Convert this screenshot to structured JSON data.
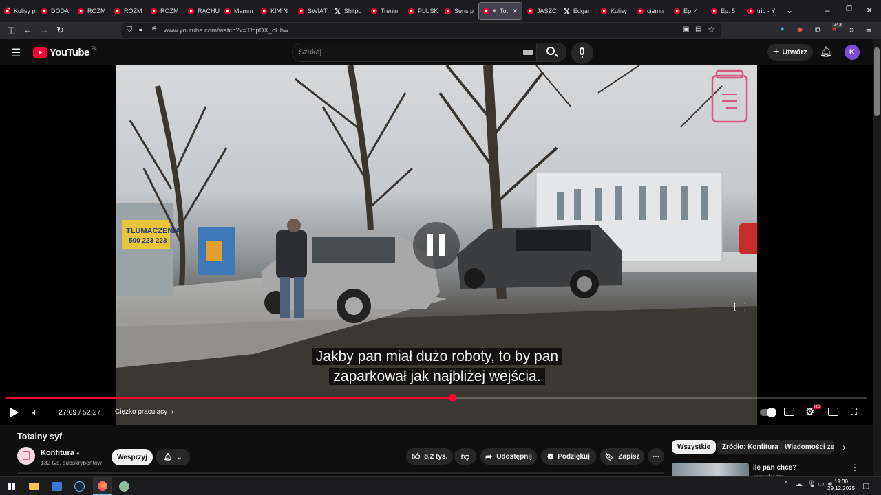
{
  "browser": {
    "tabs": [
      {
        "label": "Kulisy p",
        "icon": "youtube"
      },
      {
        "label": "DODA",
        "icon": "youtube"
      },
      {
        "label": "ROZM",
        "icon": "youtube"
      },
      {
        "label": "ROZM",
        "icon": "youtube"
      },
      {
        "label": "ROZM",
        "icon": "youtube"
      },
      {
        "label": "RACHU",
        "icon": "youtube"
      },
      {
        "label": "Mamm",
        "icon": "youtube"
      },
      {
        "label": "KIM N",
        "icon": "youtube"
      },
      {
        "label": "ŚWIĄT",
        "icon": "youtube"
      },
      {
        "label": "Shitpo",
        "icon": "x"
      },
      {
        "label": "Trenin",
        "icon": "youtube"
      },
      {
        "label": "PLUSK",
        "icon": "youtube"
      },
      {
        "label": "Sens p",
        "icon": "youtube"
      },
      {
        "label": "Tot",
        "icon": "youtube",
        "active": true
      },
      {
        "label": "JASZC",
        "icon": "youtube"
      },
      {
        "label": "Edgar",
        "icon": "x"
      },
      {
        "label": "Kulisy",
        "icon": "youtube"
      },
      {
        "label": "ciemn",
        "icon": "youtube"
      },
      {
        "label": "Ep. 4",
        "icon": "youtube"
      },
      {
        "label": "Ep. 5",
        "icon": "youtube"
      },
      {
        "label": "trip - Y",
        "icon": "youtube"
      }
    ],
    "url": "www.youtube.com/watch?v=TfcpDX_cHbw",
    "extension_badge": "243"
  },
  "youtube": {
    "logo": "YouTube",
    "region": "PL",
    "search_placeholder": "Szukaj",
    "create_label": "Utwórz",
    "avatar_letter": "K"
  },
  "player": {
    "caption_line1": "Jakby pan miał dużo roboty, to by pan",
    "caption_line2": "zaparkował jak najbliżej wejścia.",
    "current_time": "27:09",
    "duration": "52:27",
    "time_separator": "/",
    "chapter": "Ciężko pracujący",
    "progress_fraction": 0.518,
    "settings_badge": "HD",
    "sign_text": "TŁUMACZENIA",
    "sign_phone": "500 223 223",
    "state": "paused-indicator"
  },
  "video_info": {
    "title": "Totalny syf",
    "channel": "Konfitura",
    "subscribers": "132 tys. subskrybentów",
    "support_label": "Wesprzyj",
    "likes": "8,2 tys.",
    "share_label": "Udostępnij",
    "thanks_label": "Podziękuj",
    "save_label": "Zapisz"
  },
  "sidebar": {
    "chips": [
      "Wszystkie",
      "Źródło: Konfitura",
      "Wiadomości ze s"
    ],
    "next_video_title": "ile pan chce?",
    "next_video_channel": "samochodzą"
  },
  "taskbar": {
    "time": "19:30",
    "date": "29.12.2025"
  },
  "colors": {
    "accent": "#ff0033",
    "background": "#0f0f0f",
    "chip_bg": "#272727",
    "avatar": "#7b4ad8"
  }
}
